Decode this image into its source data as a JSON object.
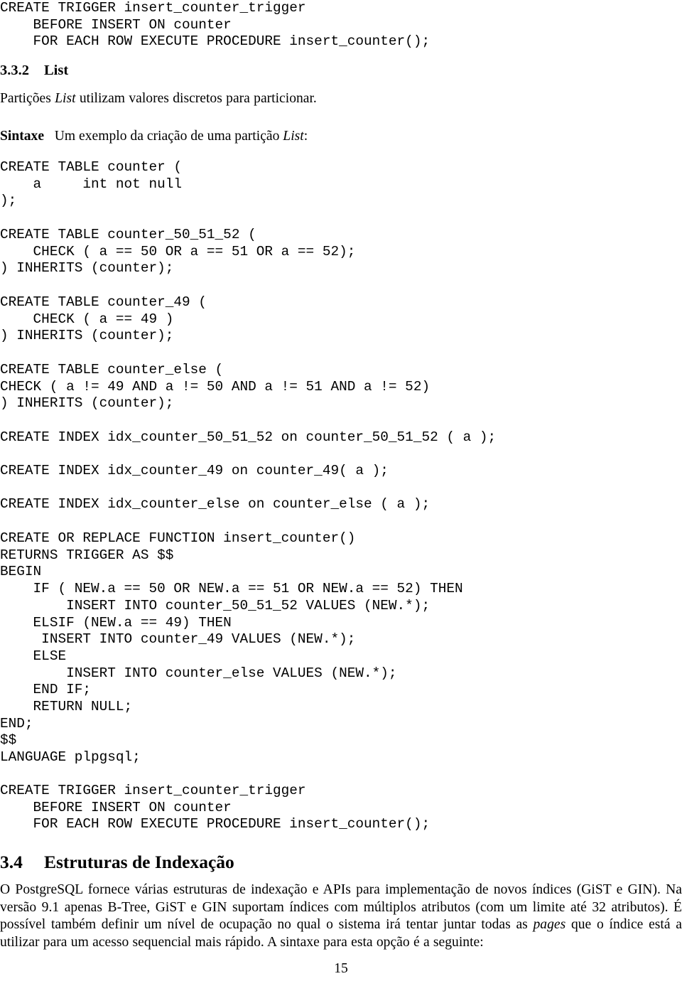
{
  "document": {
    "page_number": "15",
    "language": "pt-BR"
  },
  "blocks": {
    "trigger_top": "CREATE TRIGGER insert_counter_trigger\n    BEFORE INSERT ON counter\n    FOR EACH ROW EXECUTE PROCEDURE insert_counter();",
    "create_table_counter": "CREATE TABLE counter (\n    a     int not null\n);",
    "create_table_50_51_52": "CREATE TABLE counter_50_51_52 (\n    CHECK ( a == 50 OR a == 51 OR a == 52);\n) INHERITS (counter);",
    "create_table_49": "CREATE TABLE counter_49 (\n    CHECK ( a == 49 )\n) INHERITS (counter);",
    "create_table_else": "CREATE TABLE counter_else (\nCHECK ( a != 49 AND a != 50 AND a != 51 AND a != 52)\n) INHERITS (counter);",
    "create_index_50_51_52": "CREATE INDEX idx_counter_50_51_52 on counter_50_51_52 ( a );",
    "create_index_49": "CREATE INDEX idx_counter_49 on counter_49( a );",
    "create_index_else": "CREATE INDEX idx_counter_else on counter_else ( a );",
    "create_function": "CREATE OR REPLACE FUNCTION insert_counter()\nRETURNS TRIGGER AS $$\nBEGIN\n    IF ( NEW.a == 50 OR NEW.a == 51 OR NEW.a == 52) THEN\n        INSERT INTO counter_50_51_52 VALUES (NEW.*);\n    ELSIF (NEW.a == 49) THEN\n     INSERT INTO counter_49 VALUES (NEW.*);\n    ELSE\n        INSERT INTO counter_else VALUES (NEW.*);\n    END IF;\n    RETURN NULL;\nEND;\n$$\nLANGUAGE plpgsql;",
    "trigger_bottom": "CREATE TRIGGER insert_counter_trigger\n    BEFORE INSERT ON counter\n    FOR EACH ROW EXECUTE PROCEDURE insert_counter();"
  },
  "headings": {
    "sub_332_number": "3.3.2",
    "sub_332_title": "List",
    "sec_34_number": "3.4",
    "sec_34_title": "Estruturas de Indexação"
  },
  "paragraphs": {
    "list_intro_before": "Partições ",
    "list_intro_italic": "List",
    "list_intro_after": " utilizam valores discretos para particionar.",
    "sintaxe_label": "Sintaxe",
    "sintaxe_before": "Um exemplo da criação de uma partição ",
    "sintaxe_italic": "List",
    "sintaxe_after": ":",
    "indexacao_p1": "O PostgreSQL fornece várias estruturas de indexação e APIs para implementação de novos índices (GiST e GIN). Na versão 9.1 apenas B-Tree, GiST e GIN suportam índices com múltiplos atributos (com um limite até 32 atributos). É possível também definir um nível de ocupação no qual o sistema irá tentar juntar todas as ",
    "indexacao_italic": "pages",
    "indexacao_p2": " que o índice está a utilizar para um acesso sequencial mais rápido. A sintaxe para esta opção é a seguinte:"
  }
}
